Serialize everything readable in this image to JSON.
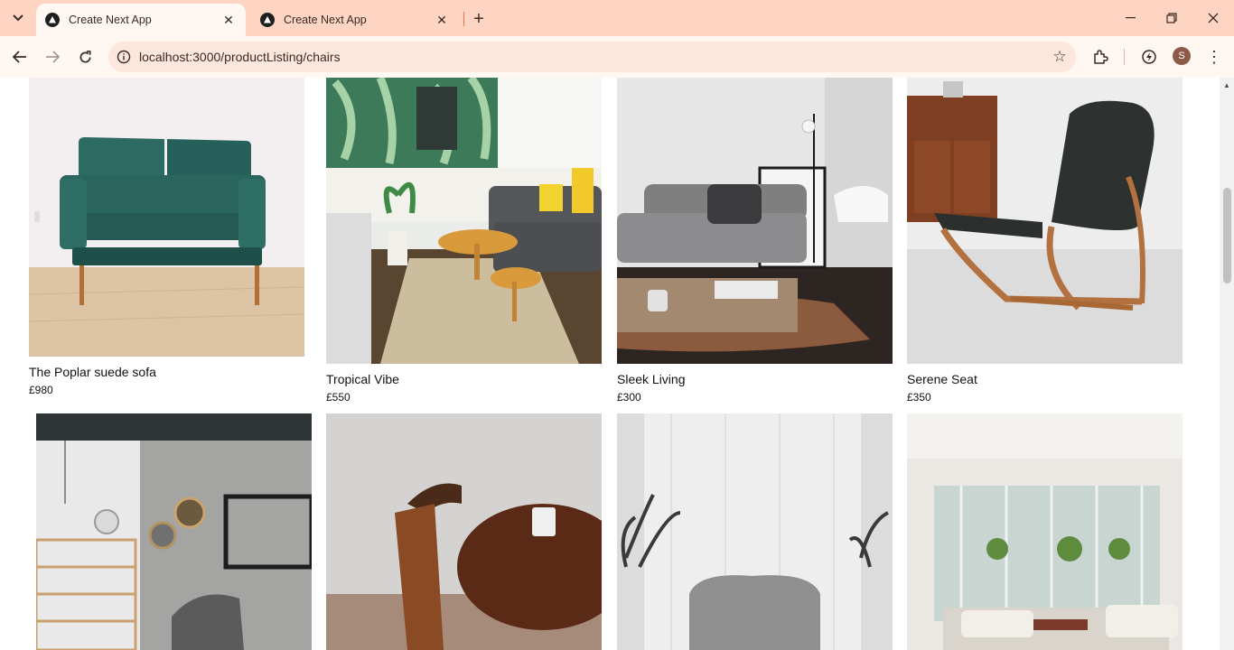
{
  "browser": {
    "tabs": [
      {
        "title": "Create Next App",
        "active": true
      },
      {
        "title": "Create Next App",
        "active": false
      }
    ],
    "url": "localhost:3000/productListing/chairs",
    "profile_initial": "S",
    "accent_color": "#fdd5c2"
  },
  "products": [
    {
      "name": "The Poplar suede sofa",
      "price": "£980"
    },
    {
      "name": "Tropical Vibe",
      "price": "£550"
    },
    {
      "name": "Sleek Living",
      "price": "£300"
    },
    {
      "name": "Serene Seat",
      "price": "£350"
    },
    {
      "name": "",
      "price": ""
    },
    {
      "name": "",
      "price": ""
    },
    {
      "name": "",
      "price": ""
    },
    {
      "name": "",
      "price": ""
    }
  ]
}
